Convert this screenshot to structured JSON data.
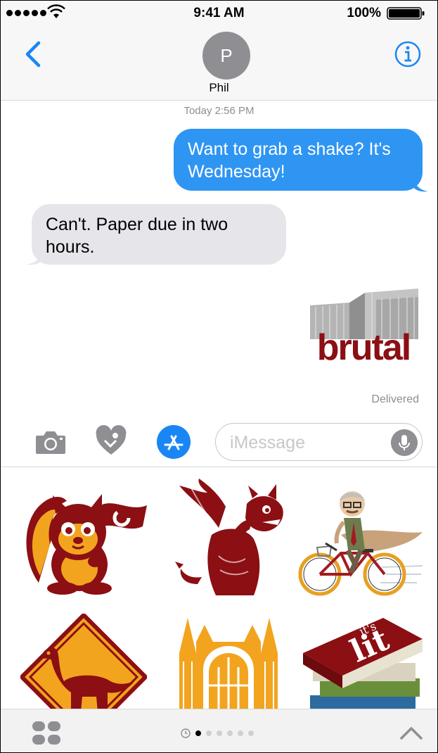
{
  "status_bar": {
    "time": "9:41 AM",
    "battery_percent": "100%",
    "signal_bars": 5,
    "icons": [
      "signal-dots-icon",
      "wifi-icon",
      "battery-icon"
    ]
  },
  "header": {
    "avatar_initial": "P",
    "contact_name": "Phil",
    "icons": [
      "chevron-left-icon",
      "info-icon"
    ]
  },
  "conversation": {
    "timestamp": "Today 2:56 PM",
    "messages": [
      {
        "direction": "outgoing",
        "text": "Want to grab a shake? It's Wednesday!"
      },
      {
        "direction": "incoming",
        "text": "Can't. Paper due in two hours."
      }
    ],
    "sticker_sent": {
      "text": "brutal"
    },
    "delivery_status": "Delivered"
  },
  "input_bar": {
    "placeholder": "iMessage",
    "icons": [
      "camera-icon",
      "digital-touch-icon",
      "app-store-icon",
      "microphone-icon"
    ]
  },
  "sticker_drawer": {
    "stickers": [
      "squirrel-flag-sticker",
      "gargoyle-sticker",
      "professor-bicycle-sticker",
      "dinosaur-crossing-sign-sticker",
      "chapel-sticker",
      "lit-book-stack-sticker"
    ],
    "book_sticker_text": [
      "it's",
      "lit"
    ]
  },
  "bottom_bar": {
    "page_count": 7,
    "active_page": 1,
    "icons": [
      "app-grid-icon",
      "recents-clock-icon",
      "chevron-up-icon"
    ]
  },
  "colors": {
    "ios_blue": "#2f95f3",
    "incoming_bubble": "#e5e5ea",
    "maroon": "#8b0f13",
    "gold": "#f2a41f",
    "gray_text": "#8e8e93"
  }
}
